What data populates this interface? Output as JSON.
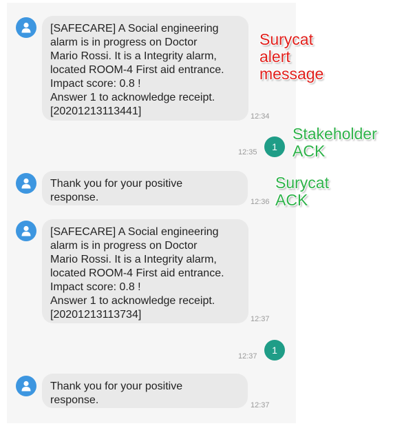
{
  "colors": {
    "avatar": "#3d96e0",
    "reply_badge": "#1f9d87",
    "bubble": "#e9e9e9",
    "annotation_red": "#e0201c",
    "annotation_green": "#2fb24a"
  },
  "messages": [
    {
      "text": "[SAFECARE] A Social engineering\nalarm is in progress on Doctor\nMario Rossi. It is a Integrity alarm,\nlocated ROOM-4 First aid entrance.\nImpact score: 0.8 !\nAnswer 1 to acknowledge receipt.\n[20201213113441]",
      "time": "12:34"
    },
    {
      "reply": "1",
      "time": "12:35"
    },
    {
      "text": " Thank you for your positive\nresponse.",
      "time": "12:36"
    },
    {
      "text": "[SAFECARE] A Social engineering\nalarm is in progress on Doctor\nMario Rossi. It is a Integrity alarm,\nlocated ROOM-4 First aid entrance.\nImpact score: 0.8 !\nAnswer 1 to acknowledge receipt.\n[20201213113734]",
      "time": "12:37"
    },
    {
      "reply": "1",
      "time": "12:37"
    },
    {
      "text": " Thank you for your positive\nresponse.",
      "time": "12:37"
    }
  ],
  "annotations": {
    "alert": "Surycat\nalert\nmessage",
    "stakeholder_ack": "Stakeholder\nACK",
    "surycat_ack": "Surycat\nACK"
  }
}
